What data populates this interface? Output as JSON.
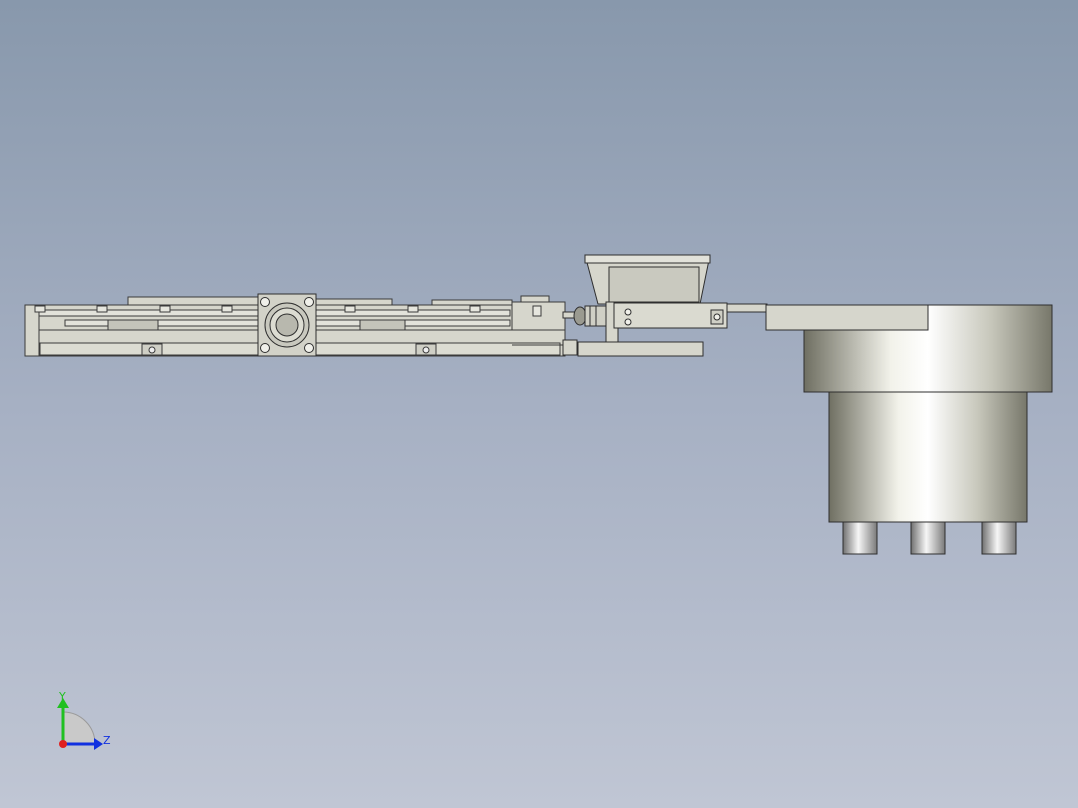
{
  "viewport": {
    "background_top": "#8898ac",
    "background_bottom": "#c0c6d4"
  },
  "model": {
    "part_fill": "#d6d6cc",
    "part_stroke": "#3a3a3a",
    "metal_light": "#f2f2ea",
    "metal_dark": "#6f6f62"
  },
  "triad": {
    "y_label": "Y",
    "z_label": "Z",
    "y_color": "#20c020",
    "z_color": "#1030e0",
    "x_color": "#e02020"
  }
}
